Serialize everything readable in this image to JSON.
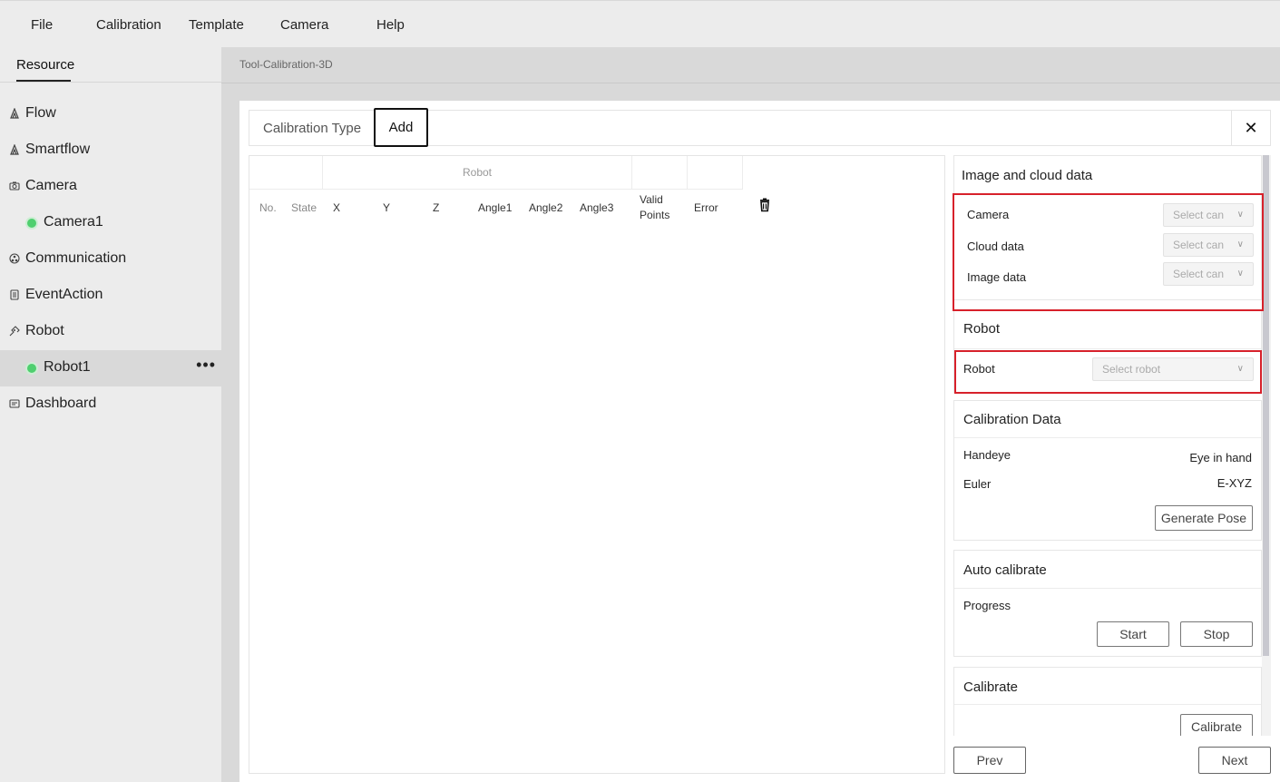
{
  "menu": [
    "File",
    "Calibration",
    "Template",
    "Camera",
    "Help"
  ],
  "sidebar": {
    "tab": "Resource",
    "items": [
      {
        "label": "Flow",
        "icon": "flow-icon"
      },
      {
        "label": "Smartflow",
        "icon": "smartflow-icon"
      },
      {
        "label": "Camera",
        "icon": "camera-icon"
      },
      {
        "label": "Camera1",
        "icon": "status-dot",
        "child": true
      },
      {
        "label": "Communication",
        "icon": "communication-icon"
      },
      {
        "label": "EventAction",
        "icon": "event-icon"
      },
      {
        "label": "Robot",
        "icon": "robot-icon"
      },
      {
        "label": "Robot1",
        "icon": "status-dot",
        "child": true,
        "selected": true,
        "more": "•••"
      },
      {
        "label": "Dashboard",
        "icon": "dashboard-icon"
      }
    ]
  },
  "breadcrumb": "Tool-Calibration-3D",
  "tabs": {
    "calibration_type": "Calibration Type",
    "add": "Add",
    "close": "✕"
  },
  "table": {
    "group_header": "Robot",
    "columns": [
      "No.",
      "State",
      "X",
      "Y",
      "Z",
      "Angle1",
      "Angle2",
      "Angle3",
      "Valid Points",
      "Error"
    ]
  },
  "right": {
    "image_cloud": {
      "title": "Image and cloud data",
      "camera_label": "Camera",
      "camera_placeholder": "Select can",
      "cloud_label": "Cloud data",
      "cloud_placeholder": "Select can",
      "image_label": "Image data",
      "image_placeholder": "Select can"
    },
    "robot": {
      "title": "Robot",
      "robot_label": "Robot",
      "robot_placeholder": "Select robot"
    },
    "calibration_data": {
      "title": "Calibration Data",
      "handeye_label": "Handeye",
      "handeye_value": "Eye in hand",
      "euler_label": "Euler",
      "euler_value": "E-XYZ",
      "generate_button": "Generate Pose"
    },
    "auto_calibrate": {
      "title": "Auto calibrate",
      "progress_label": "Progress",
      "start_button": "Start",
      "stop_button": "Stop"
    },
    "calibrate": {
      "title": "Calibrate",
      "calibrate_button": "Calibrate"
    }
  },
  "footer": {
    "prev": "Prev",
    "next": "Next"
  },
  "colors": {
    "highlight_box": "#d7212b",
    "status_dot": "#4fcf6f",
    "selected_row": "#d9d9d9"
  }
}
